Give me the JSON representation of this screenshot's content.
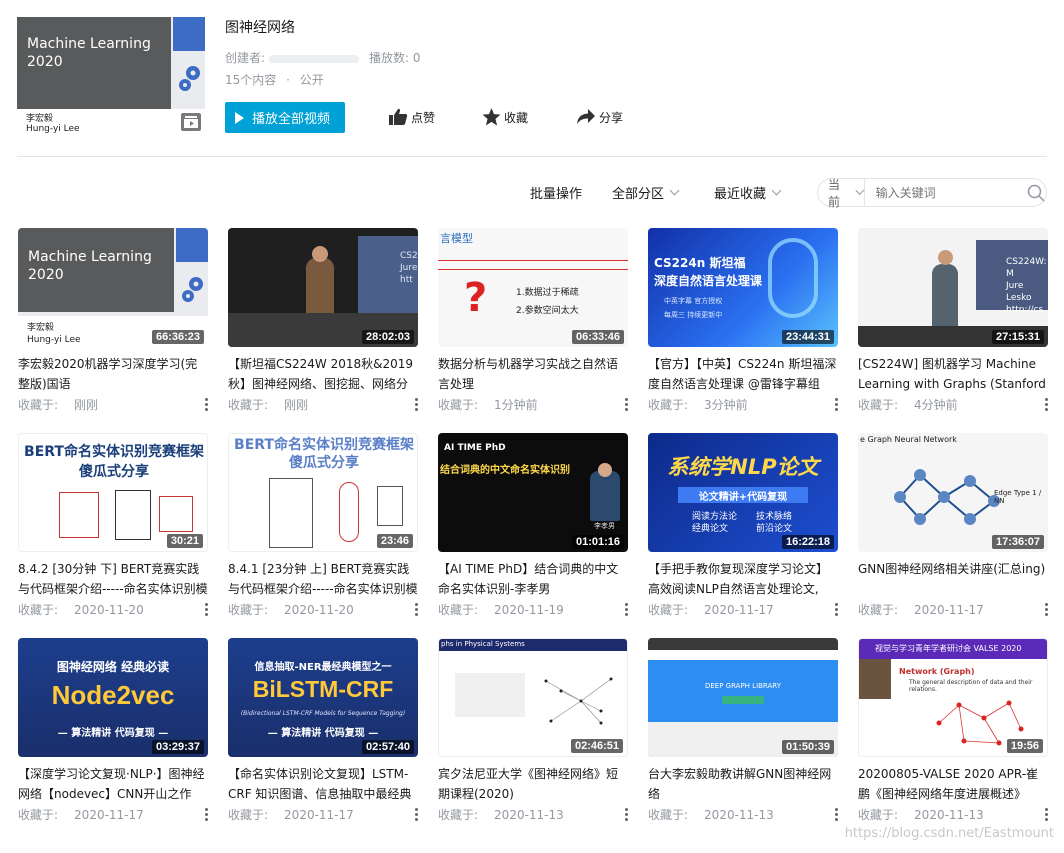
{
  "header": {
    "cover": {
      "line1": "Machine Learning",
      "line2": "2020",
      "name_cn": "李宏毅",
      "name_en": "Hung-yi Lee"
    },
    "title": "图神经网络",
    "creator_label": "创建者:",
    "plays_label": "播放数: 0",
    "count": "15个内容",
    "dot": "·",
    "visibility": "公开",
    "play_all": "播放全部视频",
    "like": "点赞",
    "favorite": "收藏",
    "share": "分享"
  },
  "toolbar": {
    "batch": "批量操作",
    "partition": "全部分区",
    "sort": "最近收藏",
    "scope": "当前",
    "search_placeholder": "输入关键词"
  },
  "videos": [
    {
      "thumb_lines": [
        "Machine Learning",
        "2020"
      ],
      "thumb_sub": [
        "李宏毅",
        "Hung-yi Lee"
      ],
      "duration": "66:36:23",
      "title": "李宏毅2020机器学习深度学习(完整版)国语",
      "label": "收藏于:",
      "date": "刚刚"
    },
    {
      "thumb_lines": [
        "CS2",
        "Jure",
        "htt"
      ],
      "duration": "28:02:03",
      "title": "【斯坦福CS224W 2018秋&2019秋】图神经网络、图挖掘、网络分",
      "label": "收藏于:",
      "date": "刚刚"
    },
    {
      "thumb_lines": [
        "言模型",
        "1.数据过于稀疏",
        "2.参数空间太大"
      ],
      "duration": "06:33:46",
      "title": "数据分析与机器学习实战之自然语言处理",
      "label": "收藏于:",
      "date": "1分钟前"
    },
    {
      "thumb_lines": [
        "CS224n 斯坦福",
        "深度自然语言处理课",
        "中英字幕 官方授权",
        "每周三 持续更新中"
      ],
      "duration": "23:44:31",
      "title": "【官方】【中英】CS224n 斯坦福深度自然语言处理课 @雷锋字幕组",
      "label": "收藏于:",
      "date": "3分钟前"
    },
    {
      "thumb_lines": [
        "CS224W: M",
        "Jure Lesko",
        "http://cs"
      ],
      "duration": "27:15:31",
      "title": "[CS224W] 图机器学习 Machine Learning with Graphs (Stanford /",
      "label": "收藏于:",
      "date": "4分钟前"
    },
    {
      "thumb_lines": [
        "BERT命名实体识别竞赛框架",
        "傻瓜式分享"
      ],
      "duration": "30:21",
      "title": "8.4.2 [30分钟 下] BERT竞赛实践与代码框架介绍-----命名实体识别模",
      "label": "收藏于:",
      "date": "2020-11-20"
    },
    {
      "thumb_lines": [
        "BERT命名实体识别竞赛框架",
        "傻瓜式分享"
      ],
      "duration": "23:46",
      "title": "8.4.1 [23分钟 上] BERT竞赛实践与代码框架介绍-----命名实体识别模",
      "label": "收藏于:",
      "date": "2020-11-20"
    },
    {
      "thumb_lines": [
        "AI TIME PhD",
        "结合词典的中文命名实体识别",
        "李孝男"
      ],
      "duration": "01:01:16",
      "title": "【AI TIME PhD】结合词典的中文命名实体识别-李孝男",
      "label": "收藏于:",
      "date": "2020-11-19"
    },
    {
      "thumb_lines": [
        "系统学NLP论文",
        "论文精讲+代码复现",
        "阅读方法论",
        "技术脉络",
        "经典论文",
        "前沿论文"
      ],
      "duration": "16:22:18",
      "title": "【手把手教你复现深度学习论文】高效阅读NLP自然语言处理论文,",
      "label": "收藏于:",
      "date": "2020-11-17"
    },
    {
      "thumb_lines": [
        "e Graph Neural Network",
        "Edge Type 1 / NN"
      ],
      "duration": "17:36:07",
      "title": "GNN图神经网络相关讲座(汇总ing)",
      "label": "收藏于:",
      "date": "2020-11-17"
    },
    {
      "thumb_lines": [
        "图神经网络 经典必读",
        "Node2vec",
        "— 算法精讲 代码复现 —"
      ],
      "duration": "03:29:37",
      "title": "【深度学习论文复现·NLP·】图神经网络【nodevec】CNN开山之作",
      "label": "收藏于:",
      "date": "2020-11-17"
    },
    {
      "thumb_lines": [
        "信息抽取-NER最经典模型之一",
        "BiLSTM-CRF",
        "(Bidirectional LSTM-CRF Models for Sequence Tagging)",
        "— 算法精讲 代码复现 —"
      ],
      "duration": "02:57:40",
      "title": "【命名实体识别论文复现】LSTM-CRF 知识图谱、信息抽取中最经典",
      "label": "收藏于:",
      "date": "2020-11-17"
    },
    {
      "thumb_lines": [
        "phs in Physical Systems"
      ],
      "duration": "02:46:51",
      "title": "宾夕法尼亚大学《图神经网络》短期课程(2020)",
      "label": "收藏于:",
      "date": "2020-11-13"
    },
    {
      "thumb_lines": [
        "DEEP GRAPH LIBRARY"
      ],
      "duration": "01:50:39",
      "title": "台大李宏毅助教讲解GNN图神经网络",
      "label": "收藏于:",
      "date": "2020-11-13"
    },
    {
      "thumb_lines": [
        "视觉与学习青年学者研讨会 VALSE 2020",
        "Network (Graph)",
        "The general description of data and their relations."
      ],
      "duration": "19:56",
      "title": "20200805-VALSE 2020 APR-崔鹏《图神经网络年度进展概述》",
      "label": "收藏于:",
      "date": "2020-11-13"
    }
  ],
  "watermark": "https://blog.csdn.net/Eastmount"
}
